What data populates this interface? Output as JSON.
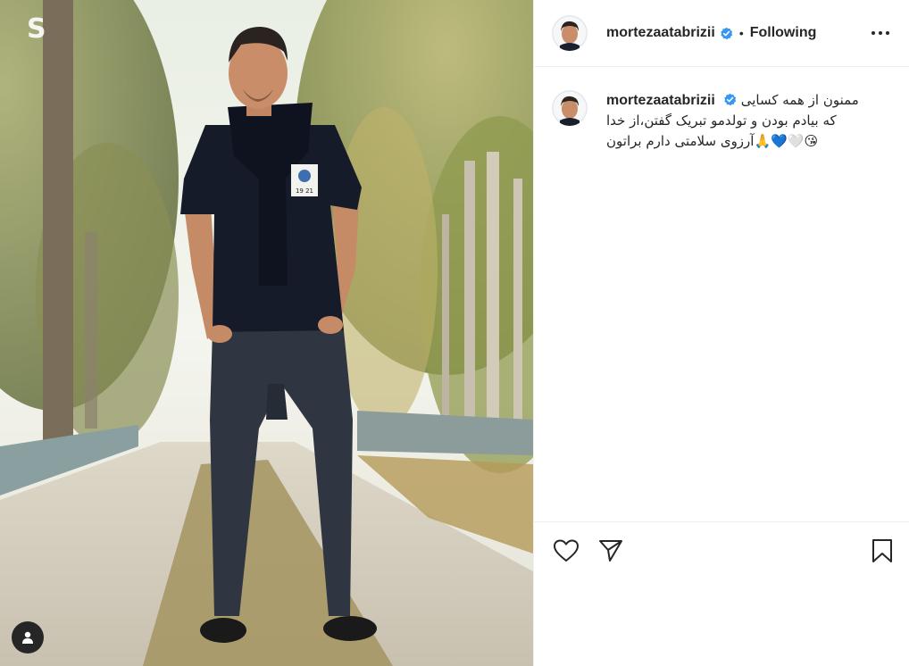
{
  "post": {
    "username": "mortezaatabrizii",
    "verified": true,
    "separator": "•",
    "follow_status": "Following",
    "more_icon": "more-horizontal-icon",
    "caption": {
      "username": "mortezaatabrizii",
      "lines": [
        "ممنون از همه کسایی",
        "که بیادم بودن و تولدمو تبریک گفتن،از خدا",
        "😘🤍💙🙏آرزوی سلامتی دارم براتون"
      ]
    },
    "actions": {
      "like_icon": "heart-icon",
      "share_icon": "send-icon",
      "save_icon": "bookmark-icon"
    },
    "media": {
      "description_icon": "tagged-user-icon",
      "shirt_badge": "19 21"
    }
  },
  "colors": {
    "text": "#262626",
    "verified": "#3897f0",
    "divider": "#efefef"
  }
}
